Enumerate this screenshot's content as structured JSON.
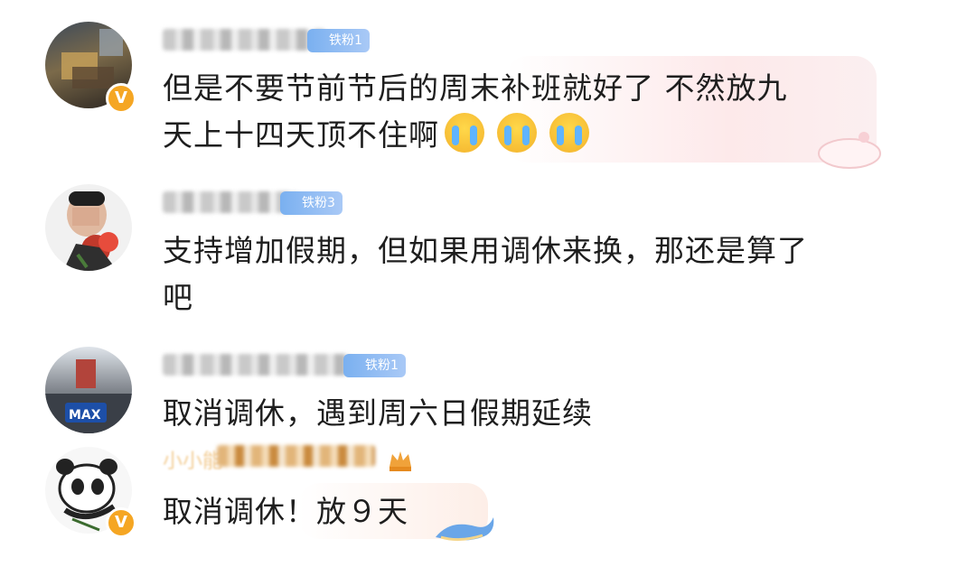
{
  "comments": [
    {
      "fan_label": "铁粉1",
      "text_line1": "但是不要节前节后的周末补班就好了 不然放九",
      "text_line2": "天上十四天顶不住啊",
      "emojis": [
        "crying-emoji",
        "crying-emoji",
        "crying-emoji"
      ],
      "verified": true
    },
    {
      "fan_label": "铁粉3",
      "text_line1": "支持增加假期，但如果用调休来换，那还是算了",
      "text_line2": "吧",
      "verified": false
    },
    {
      "fan_label": "铁粉1",
      "text_line1": "取消调休，遇到周六日假期延续",
      "avatar_text": "MAX",
      "verified": false
    },
    {
      "name_partial": "小小能",
      "text_line1": "取消调休！放９天",
      "verified": true
    }
  ],
  "colors": {
    "verified_badge": "#f5a623",
    "fan_badge": "#7ab0f0",
    "text": "#1e1e1e"
  }
}
